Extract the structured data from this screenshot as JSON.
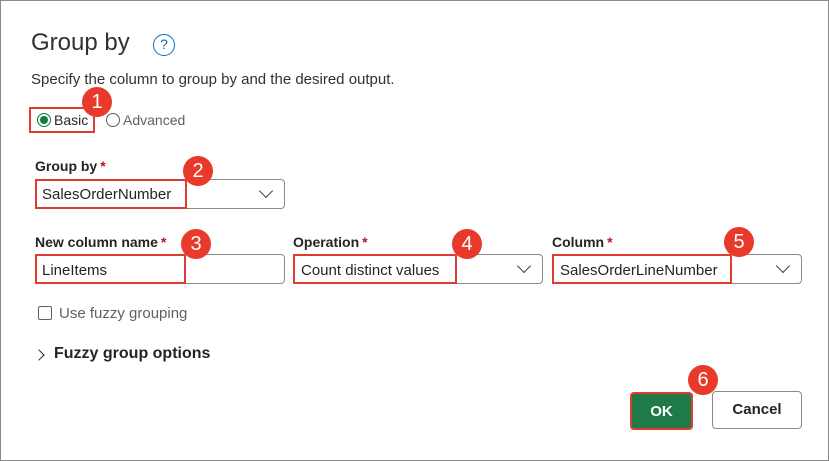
{
  "dialog": {
    "title": "Group by",
    "help_icon": "question-circle-icon",
    "description": "Specify the column to group by and the desired output."
  },
  "mode": {
    "options": [
      {
        "label": "Basic",
        "selected": true
      },
      {
        "label": "Advanced",
        "selected": false
      }
    ]
  },
  "group_by": {
    "label": "Group by",
    "required_mark": "*",
    "value": "SalesOrderNumber"
  },
  "aggregation": {
    "new_column_name": {
      "label": "New column name",
      "required_mark": "*",
      "value": "LineItems"
    },
    "operation": {
      "label": "Operation",
      "required_mark": "*",
      "value": "Count distinct values"
    },
    "column": {
      "label": "Column",
      "required_mark": "*",
      "value": "SalesOrderLineNumber"
    }
  },
  "fuzzy": {
    "checkbox_label": "Use fuzzy grouping",
    "checked": false,
    "options_label": "Fuzzy group options"
  },
  "buttons": {
    "ok": "OK",
    "cancel": "Cancel"
  },
  "callouts": [
    "1",
    "2",
    "3",
    "4",
    "5",
    "6"
  ],
  "colors": {
    "accent_green": "#107c41",
    "ok_button": "#1e7a46",
    "callout_red": "#e8392b",
    "highlight_red": "#e03c31",
    "help_blue": "#0f6cbd"
  }
}
